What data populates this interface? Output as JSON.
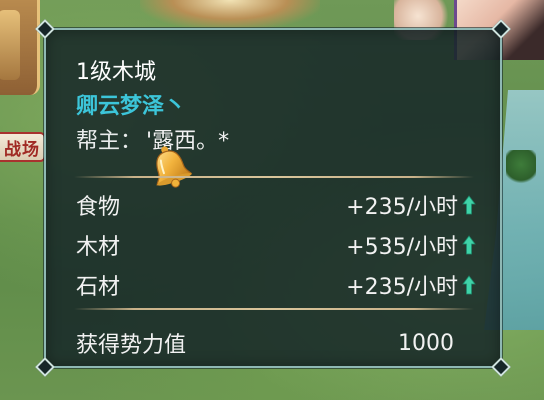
{
  "background": {
    "side_label": "战场"
  },
  "tooltip": {
    "title": "1级木城",
    "owner_name": "卿云梦泽丶",
    "leader_label": "帮主：",
    "leader_name": "'露西。*",
    "resources": [
      {
        "name": "食物",
        "rate": "+235/小时",
        "trend_icon": "up-arrow-icon"
      },
      {
        "name": "木材",
        "rate": "+535/小时",
        "trend_icon": "up-arrow-icon"
      },
      {
        "name": "石材",
        "rate": "+235/小时",
        "trend_icon": "up-arrow-icon"
      }
    ],
    "influence_label": "获得势力值",
    "influence_value": "1000"
  },
  "colors": {
    "panel_bg": "#162628",
    "panel_border": "#8fb8b4",
    "owner_name": "#3cc5d9",
    "arrow": "#3fd3a8",
    "divider": "#c9b28a"
  }
}
